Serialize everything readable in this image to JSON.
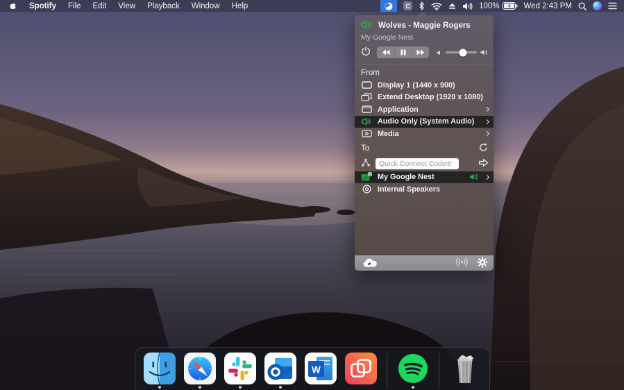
{
  "menu_bar": {
    "app_name": "Spotify",
    "menus": [
      "File",
      "Edit",
      "View",
      "Playback",
      "Window",
      "Help"
    ],
    "status": {
      "c_icon_label": "C",
      "battery_percent": "100%",
      "clock": "Wed 2:43 PM"
    }
  },
  "panel": {
    "now_playing": {
      "title": "Wolves - Maggie Rogers",
      "device": "My Google Nest"
    },
    "controls": {
      "volume_level": 0.55
    },
    "from": {
      "label": "From",
      "items": [
        {
          "label": "Display 1 (1440 x 900)",
          "icon": "display-icon",
          "chevron": false,
          "selected": false
        },
        {
          "label": "Extend Desktop (1920 x 1080)",
          "icon": "extend-desktop-icon",
          "chevron": false,
          "selected": false
        },
        {
          "label": "Application",
          "icon": "application-window-icon",
          "chevron": true,
          "selected": false
        },
        {
          "label": "Audio Only (System Audio)",
          "icon": "speaker-icon",
          "chevron": true,
          "selected": true
        },
        {
          "label": "Media",
          "icon": "media-play-icon",
          "chevron": true,
          "selected": false
        }
      ]
    },
    "to": {
      "label": "To",
      "quick_connect_placeholder": "Quick Connect Code®",
      "items": [
        {
          "label": "My Google Nest",
          "icon": "google-nest-cast-icon",
          "selected": true,
          "audio_active": true
        },
        {
          "label": "Internal Speakers",
          "icon": "internal-speakers-icon",
          "selected": false,
          "audio_active": false
        }
      ]
    },
    "footer_icons": [
      "airparrot-cloud-icon",
      "broadcast-icon",
      "settings-gear-icon"
    ],
    "colors": {
      "accent_green": "#2cb44b",
      "selected_row_bg": "#1e1c1e"
    }
  },
  "dock": {
    "items": [
      {
        "name": "finder",
        "running": true
      },
      {
        "name": "safari",
        "running": true
      },
      {
        "name": "slack",
        "running": true
      },
      {
        "name": "outlook",
        "running": true
      },
      {
        "name": "word",
        "running": false,
        "letter": "W"
      },
      {
        "name": "airparrot",
        "running": false
      },
      {
        "name": "spotify",
        "running": true
      },
      {
        "name": "trash",
        "running": false
      }
    ]
  }
}
